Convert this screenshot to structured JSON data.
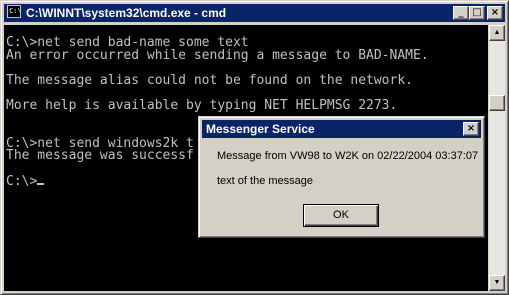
{
  "window": {
    "title": "C:\\WINNT\\system32\\cmd.exe - cmd",
    "app_icon": "cmd-icon",
    "controls": {
      "minimize": "_",
      "maximize": "□",
      "close": "×"
    },
    "colors": {
      "titlebar": "#0a246a",
      "console_bg": "#000000",
      "console_text": "#c0c0c0"
    }
  },
  "console": {
    "lines": [
      "C:\\>net send bad-name some text",
      "An error occurred while sending a message to BAD-NAME.",
      "",
      "The message alias could not be found on the network.",
      "",
      "More help is available by typing NET HELPMSG 2273.",
      "",
      "",
      "C:\\>net send windows2k t",
      "The message was successf",
      "",
      "C:\\>"
    ]
  },
  "scrollbar": {
    "up_icon": "scroll-up-arrow-icon",
    "down_icon": "scroll-down-arrow-icon"
  },
  "dialog": {
    "title": "Messenger Service",
    "close": "×",
    "message_header": "Message from VW98 to W2K on 02/22/2004 03:37:07",
    "message_body": "text of the message",
    "ok_label": "OK"
  }
}
